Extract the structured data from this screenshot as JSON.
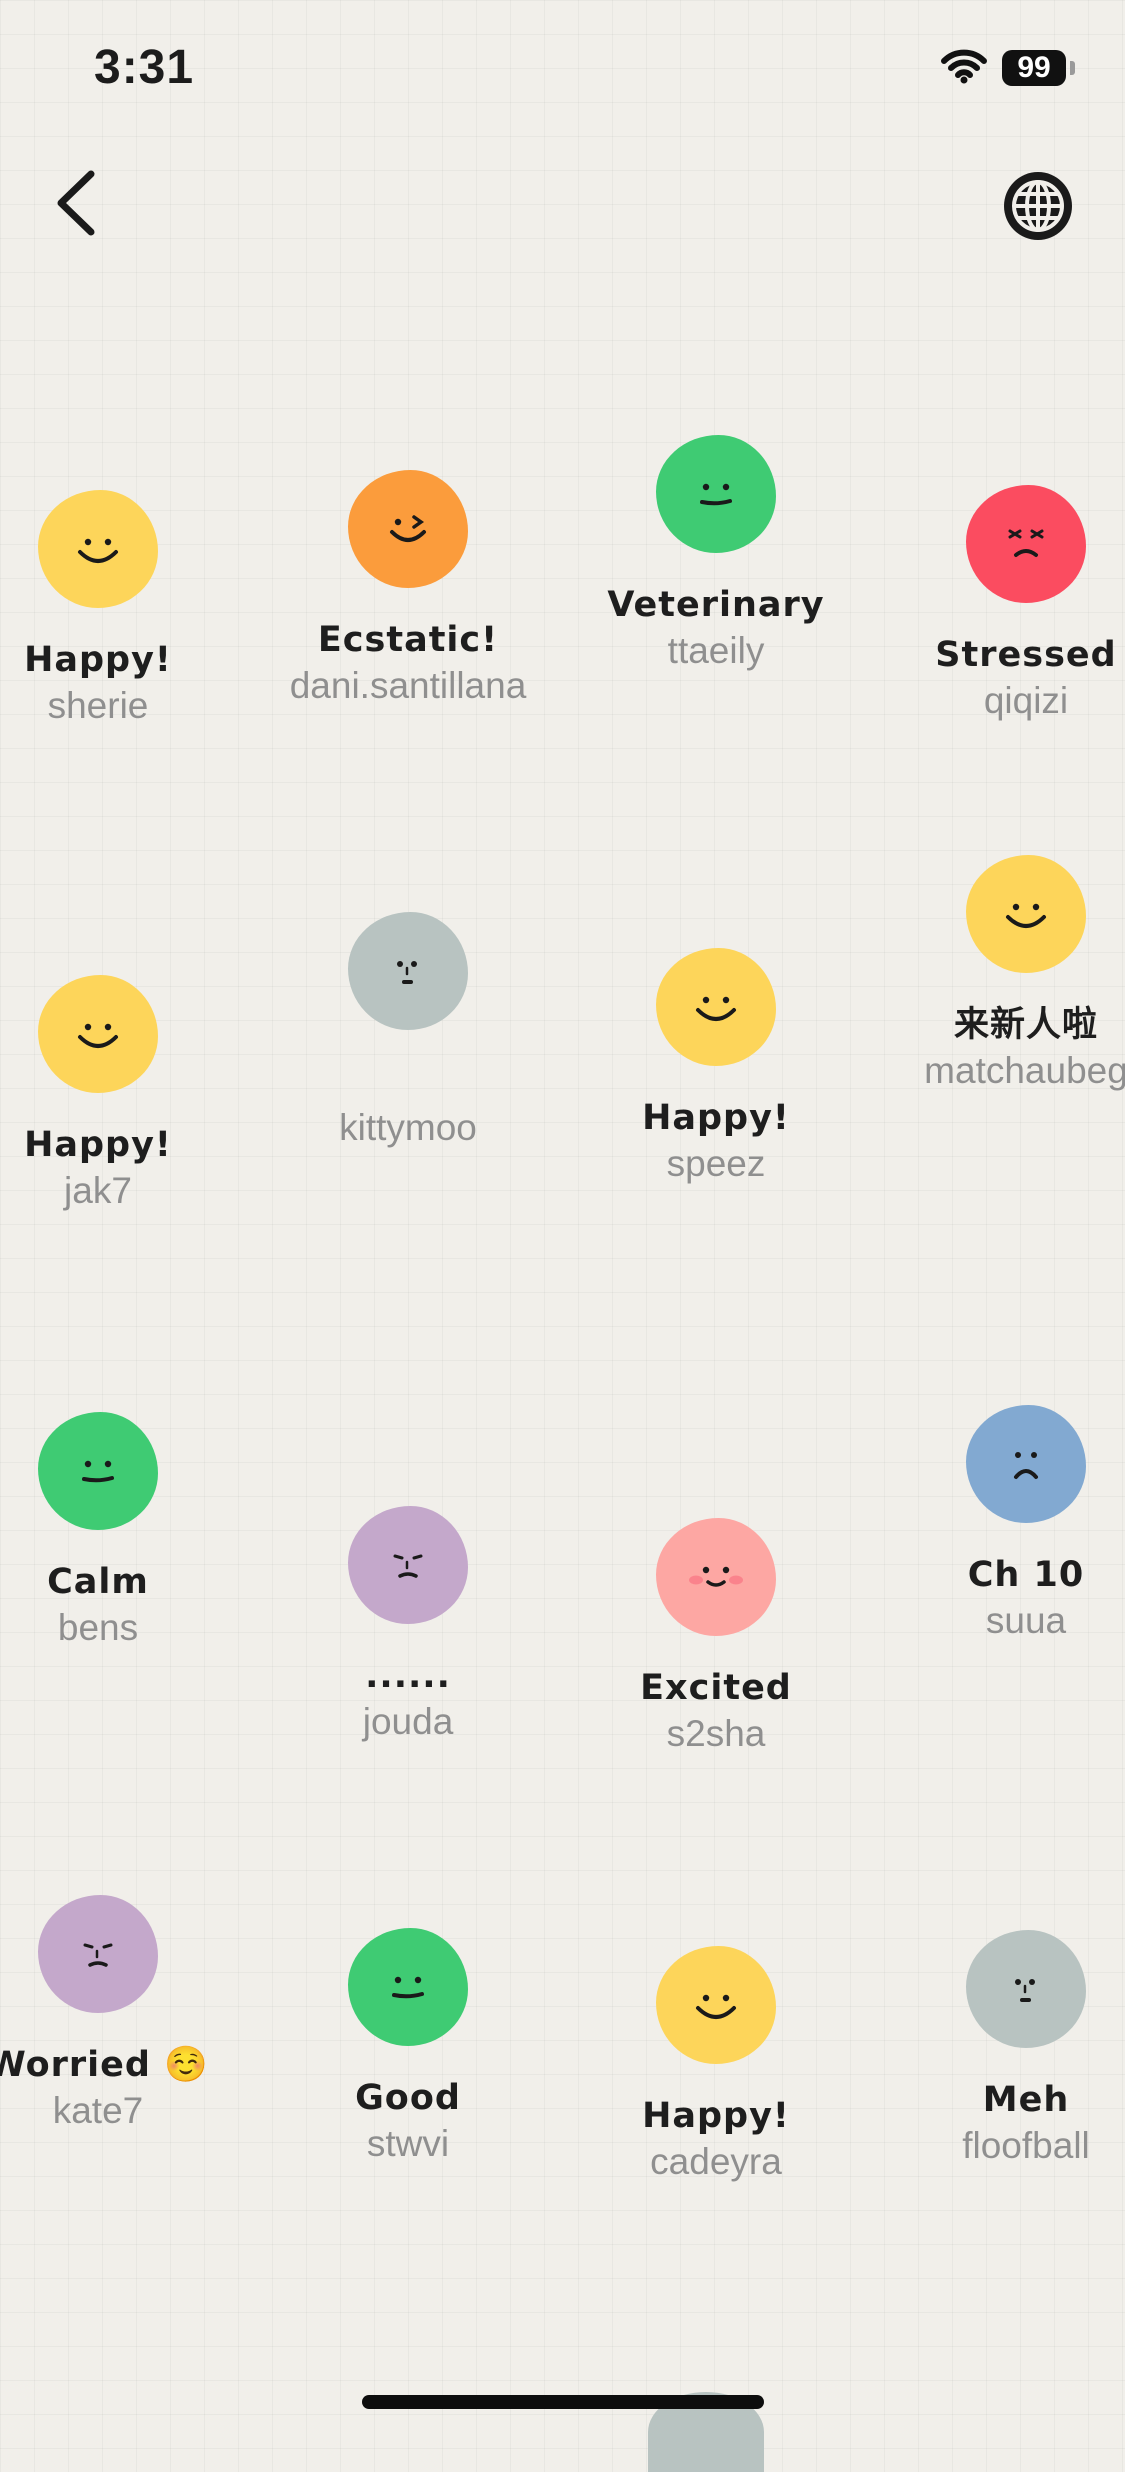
{
  "status_bar": {
    "time": "3:31",
    "battery": "99"
  },
  "nav": {
    "back_icon": "chevron-left-icon",
    "globe_icon": "globe-icon"
  },
  "colors": {
    "yellow": "#fdd55a",
    "orange": "#fb9c3c",
    "green": "#3fcb73",
    "red": "#fb4c60",
    "gray": "#b8c3c1",
    "purple": "#c4a8cb",
    "pink": "#fda7a3",
    "blue": "#82a9d1"
  },
  "users": [
    {
      "status": "Happy!",
      "username": "sherie",
      "mood": "yellow",
      "face": "happy"
    },
    {
      "status": "Ecstatic!",
      "username": "dani.santillana",
      "mood": "orange",
      "face": "wink"
    },
    {
      "status": "Veterinary",
      "username": "ttaeily",
      "mood": "green",
      "face": "calm"
    },
    {
      "status": "Stressed",
      "username": "qiqizi",
      "mood": "red",
      "face": "angry"
    },
    {
      "status": "Happy!",
      "username": "jak7",
      "mood": "yellow",
      "face": "happy"
    },
    {
      "status": "",
      "username": "kittymoo",
      "mood": "gray",
      "face": "meh"
    },
    {
      "status": "Happy!",
      "username": "speez",
      "mood": "yellow",
      "face": "happy"
    },
    {
      "status": "来新人啦",
      "username": "matchaubeg",
      "mood": "yellow",
      "face": "happy"
    },
    {
      "status": "Calm",
      "username": "bens",
      "mood": "green",
      "face": "calm"
    },
    {
      "status": "......",
      "username": "jouda",
      "mood": "purple",
      "face": "worried"
    },
    {
      "status": "Excited",
      "username": "s2sha",
      "mood": "pink",
      "face": "blush"
    },
    {
      "status": "Ch 10",
      "username": "suua",
      "mood": "blue",
      "face": "sad"
    },
    {
      "status": "Worried ☺️",
      "username": "kate7",
      "mood": "purple",
      "face": "worried"
    },
    {
      "status": "Good",
      "username": "stwvi",
      "mood": "green",
      "face": "calm"
    },
    {
      "status": "Happy!",
      "username": "cadeyra",
      "mood": "yellow",
      "face": "happy"
    },
    {
      "status": "Meh",
      "username": "floofball",
      "mood": "gray",
      "face": "meh"
    }
  ]
}
